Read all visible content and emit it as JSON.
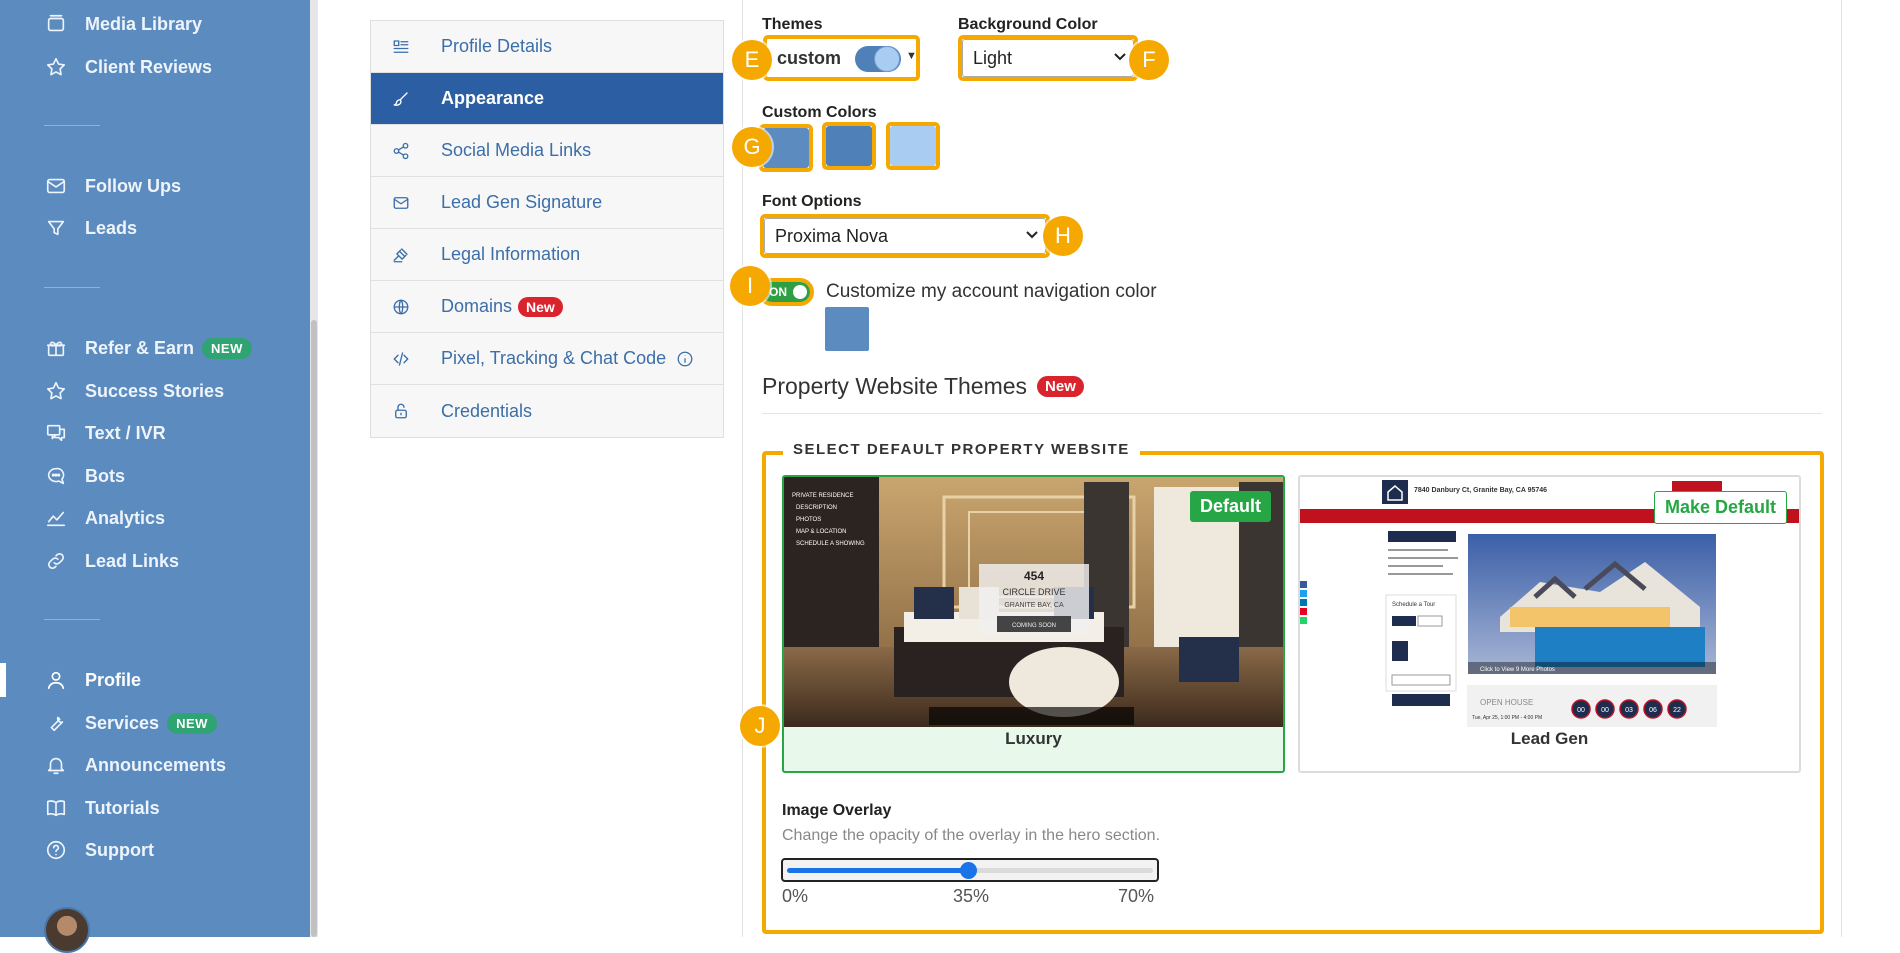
{
  "sidebar": {
    "items": [
      {
        "label": "Media Library",
        "icon": "folder-icon"
      },
      {
        "label": "Client Reviews",
        "icon": "star-icon"
      },
      {
        "label": "Follow Ups",
        "icon": "mail-icon"
      },
      {
        "label": "Leads",
        "icon": "funnel-icon"
      },
      {
        "label": "Refer & Earn",
        "icon": "gift-icon",
        "badge": "NEW"
      },
      {
        "label": "Success Stories",
        "icon": "star-icon"
      },
      {
        "label": "Text / IVR",
        "icon": "chat-icon"
      },
      {
        "label": "Bots",
        "icon": "bot-icon"
      },
      {
        "label": "Analytics",
        "icon": "chart-icon"
      },
      {
        "label": "Lead Links",
        "icon": "link-icon"
      },
      {
        "label": "Profile",
        "icon": "user-icon",
        "active": true
      },
      {
        "label": "Services",
        "icon": "wrench-icon",
        "badge": "NEW"
      },
      {
        "label": "Announcements",
        "icon": "bell-icon"
      },
      {
        "label": "Tutorials",
        "icon": "book-icon"
      },
      {
        "label": "Support",
        "icon": "help-icon"
      }
    ]
  },
  "settings_menu": {
    "items": [
      {
        "label": "Profile Details",
        "icon": "list-icon"
      },
      {
        "label": "Appearance",
        "icon": "brush-icon",
        "active": true
      },
      {
        "label": "Social Media Links",
        "icon": "share-icon"
      },
      {
        "label": "Lead Gen Signature",
        "icon": "mail-icon"
      },
      {
        "label": "Legal Information",
        "icon": "gavel-icon"
      },
      {
        "label": "Domains",
        "icon": "globe-icon",
        "badge": "New"
      },
      {
        "label": "Pixel, Tracking & Chat Code",
        "icon": "code-icon",
        "info": true
      },
      {
        "label": "Credentials",
        "icon": "lock-icon"
      }
    ]
  },
  "appearance": {
    "themes_label": "Themes",
    "theme_value": "custom",
    "background_label": "Background Color",
    "background_value": "Light",
    "custom_colors_label": "Custom Colors",
    "custom_colors": [
      "#5b8bbf",
      "#4f80b8",
      "#a9cdf2"
    ],
    "font_label": "Font Options",
    "font_value": "Proxima Nova",
    "nav_toggle_label": "ON",
    "nav_toggle_on": true,
    "nav_color_label": "Customize my account navigation color",
    "nav_color": "#5b8bbf"
  },
  "markers": {
    "e": "E",
    "f": "F",
    "g": "G",
    "h": "H",
    "i": "I",
    "j": "J"
  },
  "property_themes": {
    "title": "Property Website Themes",
    "badge": "New",
    "legend": "SELECT DEFAULT PROPERTY WEBSITE",
    "cards": [
      {
        "name": "Luxury",
        "tag": "Default",
        "selected": true,
        "thumb": {
          "address_line1": "454",
          "address_line2": "CIRCLE DRIVE",
          "address_line3": "GRANITE BAY, CA",
          "status": "COMING SOON"
        }
      },
      {
        "name": "Lead Gen",
        "tag": "Make Default",
        "selected": false,
        "thumb": {
          "address": "7840 Danbury Ct, Granite Bay, CA 95746",
          "photo_caption": "Click to View 9 More Photos",
          "schedule_title": "Schedule a Tour",
          "open_house": "OPEN HOUSE",
          "open_house_date": "Tue, Apr 25, 1:00 PM - 4:00 PM",
          "countdown": [
            "00",
            "00",
            "03",
            "06",
            "22"
          ]
        }
      }
    ]
  },
  "overlay": {
    "title": "Image Overlay",
    "description": "Change the opacity of the overlay in the hero section.",
    "value_percent": 35,
    "min_label": "0%",
    "mid_label": "35%",
    "max_label": "70%",
    "max_percent": 70
  },
  "colors": {
    "accent": "#2c5ea3",
    "highlight": "#f5a800",
    "success": "#26a644",
    "sidebar": "#5b8bbf"
  }
}
